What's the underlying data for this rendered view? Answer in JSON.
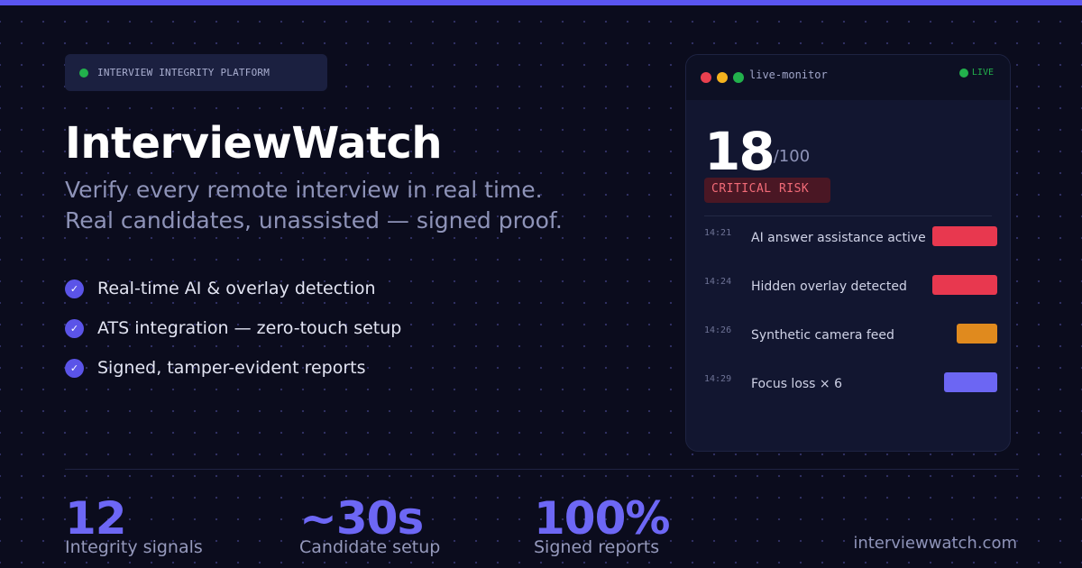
{
  "accent": "#5a55f0",
  "badge": {
    "text": "INTERVIEW INTEGRITY PLATFORM",
    "dot_color": "#22b14c"
  },
  "brand": "InterviewWatch",
  "tagline": {
    "line1": "Verify every remote interview in real time.",
    "line2": "Real candidates, unassisted — signed proof."
  },
  "features": [
    {
      "icon": "check-icon",
      "text": "Real-time AI & overlay detection"
    },
    {
      "icon": "check-icon",
      "text": "ATS integration — zero-touch setup"
    },
    {
      "icon": "check-icon",
      "text": "Signed, tamper-evident reports"
    }
  ],
  "monitor": {
    "title": "live-monitor",
    "live_label": "LIVE",
    "score": "18",
    "score_max": "/100",
    "risk_label": "CRITICAL RISK",
    "events": [
      {
        "time": "14:21",
        "label": "AI answer assistance active",
        "severity": 1.0,
        "color": "#e8384f"
      },
      {
        "time": "14:24",
        "label": "Hidden overlay detected",
        "severity": 1.0,
        "color": "#e8384f"
      },
      {
        "time": "14:26",
        "label": "Synthetic camera feed",
        "severity": 0.62,
        "color": "#e08a1e"
      },
      {
        "time": "14:29",
        "label": "Focus loss × 6",
        "severity": 0.82,
        "color": "#6c66f3"
      }
    ]
  },
  "stats": [
    {
      "value": "12",
      "label": "Integrity signals"
    },
    {
      "value": "~30s",
      "label": "Candidate setup"
    },
    {
      "value": "100%",
      "label": "Signed reports"
    }
  ],
  "site": "interviewwatch.com"
}
